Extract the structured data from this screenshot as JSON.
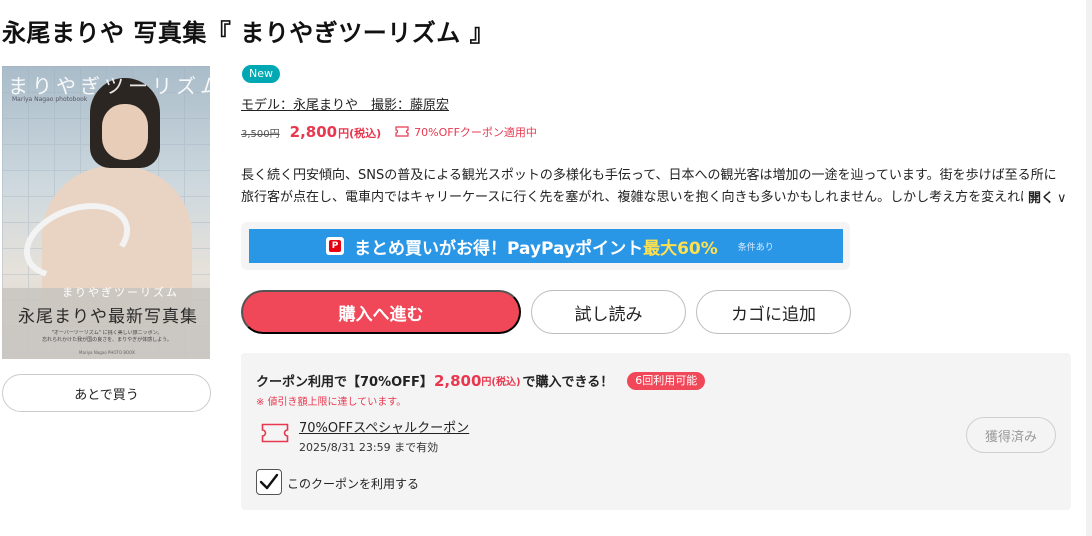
{
  "product": {
    "title": "永尾まりや 写真集『 まりやぎツーリズム 』",
    "badge": "New",
    "credit": "モデル：永尾まりや　撮影：藤原宏",
    "old_price": "3,500円",
    "price": "2,800",
    "price_unit": "円(税込)",
    "coupon_tag": "70%OFFクーポン適用中",
    "description_line1": "長く続く円安傾向、SNSの普及による観光スポットの多様化も手伝って、日本への観光客は増加の一途を辿っています。街を歩けば至る所に",
    "description_line2": "旅行客が点在し、電車内ではキャリーケースに行く先を塞がれ、複雑な思いを抱く向きも多いかもしれません。しかし考え方を変えれば",
    "open_label": "開く",
    "open_chevron": "∨"
  },
  "cover": {
    "script_title": "まりやぎツーリズム",
    "subtitle_en": "Mariya Nagao photobook",
    "band_script": "まりやぎツーリズム",
    "main_line": "永尾まりや最新写真集",
    "small_line1": "\"オーバーツーリズム\" に挑く美しい旅ニッポン。",
    "small_line2": "忘れられかけた我が国の良さを、まりやぎが体感しよう。",
    "tiny_line": "Mariya Nagao PHOTO BOOK"
  },
  "later_button": "あとで買う",
  "banner": {
    "logo_letter": "P",
    "text": "まとめ買いがお得！PayPayポイント",
    "highlight": "最大60%",
    "note": "条件あり"
  },
  "buttons": {
    "buy": "購入へ進む",
    "sample": "試し読み",
    "cart": "カゴに追加"
  },
  "coupon": {
    "head_prefix": "クーポン利用で【70%OFF】",
    "head_price": "2,800",
    "head_price_unit": "円(税込)",
    "head_suffix": "で購入できる！",
    "usage_badge": "6回利用可能",
    "warning": "※ 値引き額上限に達しています。",
    "name": "70%OFFスペシャルクーポン",
    "validity": "2025/8/31 23:59 まで有効",
    "acquired": "獲得済み",
    "use_label": "このクーポンを利用する",
    "use_checked": true
  },
  "colors": {
    "accent_red": "#f04858",
    "price_red": "#e8384f",
    "new_badge": "#00a8b3",
    "paypay_blue": "#2a96e6",
    "paypay_highlight": "#ffe14d"
  },
  "icons": {
    "coupon_tag": "ticket-icon",
    "coupon_list": "ticket-icon",
    "checkbox": "check-icon",
    "paypay": "paypay-logo-icon",
    "open": "chevron-down-icon"
  }
}
